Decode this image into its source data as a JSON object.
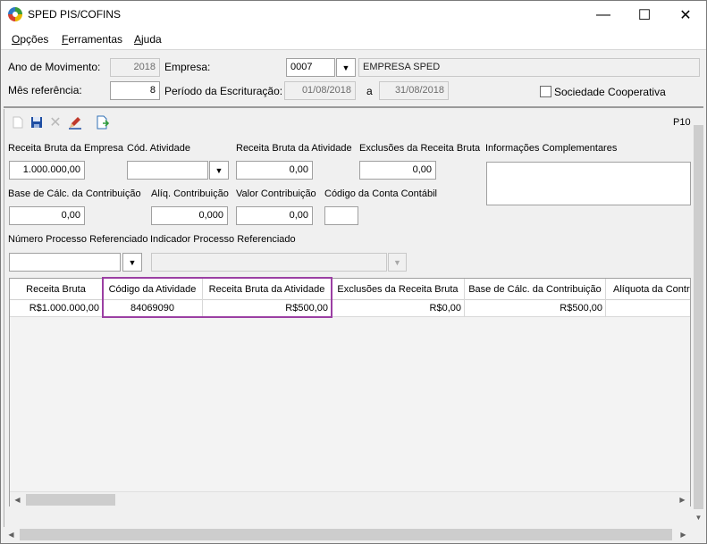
{
  "window": {
    "title": "SPED PIS/COFINS",
    "minimize": "—",
    "maximize": "☐",
    "close": "✕"
  },
  "menu": {
    "items": [
      {
        "accel": "O",
        "rest": "pções"
      },
      {
        "accel": "F",
        "rest": "erramentas"
      },
      {
        "accel": "A",
        "rest": "juda"
      }
    ]
  },
  "header": {
    "ano_label": "Ano de Movimento:",
    "ano_value": "2018",
    "empresa_label": "Empresa:",
    "empresa_code": "0007",
    "empresa_name": "EMPRESA SPED",
    "mes_label": "Mês referência:",
    "mes_value": "8",
    "periodo_label": "Período da Escrituração:",
    "periodo_inicio": "01/08/2018",
    "periodo_sep": "a",
    "periodo_fim": "31/08/2018",
    "cooperativa_label": "Sociedade Cooperativa"
  },
  "toolbar": {
    "page_label": "P10"
  },
  "form": {
    "receita_empresa_label": "Receita Bruta da Empresa",
    "receita_empresa_value": "1.000.000,00",
    "cod_atividade_label": "Cód. Atividade",
    "cod_atividade_value": "",
    "receita_atividade_label": "Receita Bruta da Atividade",
    "receita_atividade_value": "0,00",
    "exclusoes_label": "Exclusões da Receita Bruta",
    "exclusoes_value": "0,00",
    "info_label": "Informações Complementares",
    "base_label": "Base de Cálc. da Contribuição",
    "base_value": "0,00",
    "aliq_label": "Alíq. Contribuição",
    "aliq_value": "0,000",
    "valor_label": "Valor Contribuição",
    "valor_value": "0,00",
    "conta_label": "Código da Conta Contábil",
    "processo_label": "Número Processo Referenciado",
    "indicador_label": "Indicador Processo Referenciado"
  },
  "grid": {
    "columns": [
      "Receita Bruta",
      "Código da Atividade",
      "Receita Bruta da Atividade",
      "Exclusões da Receita Bruta",
      "Base de Cálc. da Contribuição",
      "Alíquota da Contr"
    ],
    "rows": [
      [
        "R$1.000.000,00",
        "84069090",
        "R$500,00",
        "R$0,00",
        "R$500,00",
        ""
      ]
    ]
  },
  "colors": {
    "highlight": "#9b3fa3"
  }
}
